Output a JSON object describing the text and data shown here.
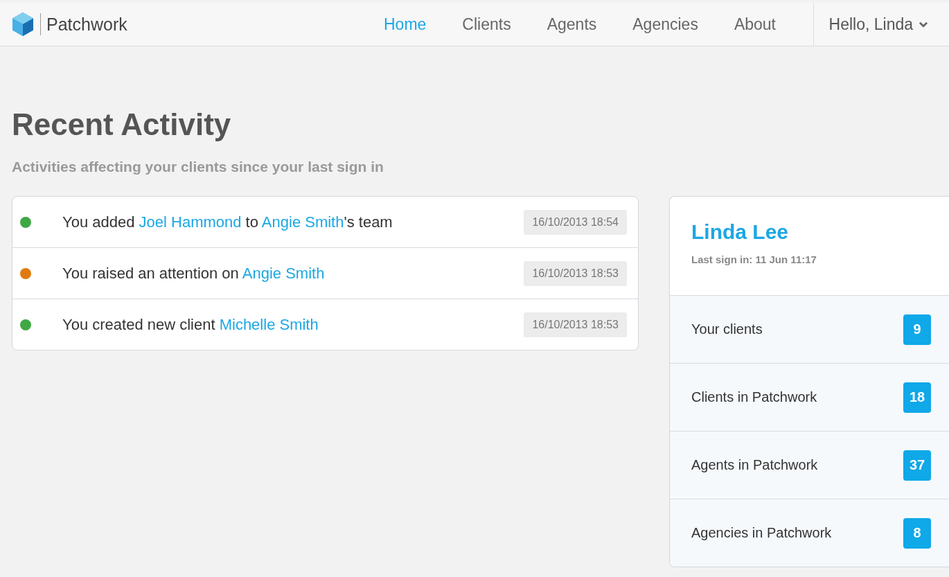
{
  "brand": {
    "name": "Patchwork"
  },
  "nav": [
    {
      "label": "Home",
      "selected": true
    },
    {
      "label": "Clients",
      "selected": false
    },
    {
      "label": "Agents",
      "selected": false
    },
    {
      "label": "Agencies",
      "selected": false
    },
    {
      "label": "About",
      "selected": false
    }
  ],
  "user_menu": {
    "label": "Hello, Linda"
  },
  "heading": "Recent Activity",
  "subheading": "Activities affecting your clients since your last sign in",
  "activities": [
    {
      "color": "#3fa845",
      "time": "16/10/2013 18:54",
      "parts": [
        {
          "kind": "text",
          "text": "You added "
        },
        {
          "kind": "link",
          "text": "Joel Hammond"
        },
        {
          "kind": "text",
          "text": " to "
        },
        {
          "kind": "link",
          "text": "Angie Smith"
        },
        {
          "kind": "text",
          "text": "'s team"
        }
      ]
    },
    {
      "color": "#e07b12",
      "time": "16/10/2013 18:53",
      "parts": [
        {
          "kind": "text",
          "text": "You raised an attention on "
        },
        {
          "kind": "link",
          "text": "Angie Smith"
        }
      ]
    },
    {
      "color": "#3fa845",
      "time": "16/10/2013 18:53",
      "parts": [
        {
          "kind": "text",
          "text": "You created new client "
        },
        {
          "kind": "link",
          "text": "Michelle Smith"
        }
      ]
    }
  ],
  "profile": {
    "name": "Linda Lee",
    "last_sign_in": "Last sign in: 11 Jun 11:17",
    "stats": [
      {
        "label": "Your clients",
        "count": "9"
      },
      {
        "label": "Clients in Patchwork",
        "count": "18"
      },
      {
        "label": "Agents in Patchwork",
        "count": "37"
      },
      {
        "label": "Agencies in Patchwork",
        "count": "8"
      }
    ]
  }
}
